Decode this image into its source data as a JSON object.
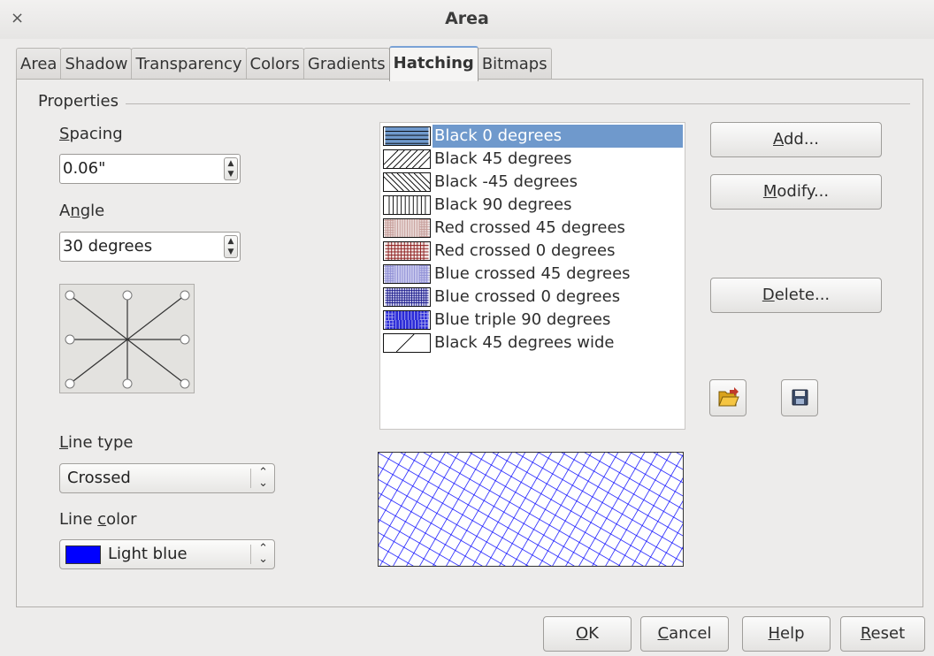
{
  "window": {
    "title": "Area",
    "close_glyph": "×"
  },
  "tabs": [
    {
      "label": "Area"
    },
    {
      "label": "Shadow"
    },
    {
      "label": "Transparency"
    },
    {
      "label": "Colors"
    },
    {
      "label": "Gradients"
    },
    {
      "label": "Hatching",
      "active": true
    },
    {
      "label": "Bitmaps"
    }
  ],
  "properties": {
    "title": "Properties",
    "spacing": {
      "label_u": "S",
      "label_rest": "pacing",
      "value": "0.06\""
    },
    "angle": {
      "label_a": "A",
      "label_u": "n",
      "label_rest": "gle",
      "value": "30 degrees"
    },
    "line_type": {
      "label_u": "L",
      "label_rest": "ine type",
      "value": "Crossed"
    },
    "line_color": {
      "label_a": "Line ",
      "label_u": "c",
      "label_rest": "olor",
      "value": "Light blue",
      "swatch": "#0000ff"
    }
  },
  "hatch_list": [
    {
      "name": "Black 0 degrees",
      "selected": true
    },
    {
      "name": "Black 45 degrees"
    },
    {
      "name": "Black -45 degrees"
    },
    {
      "name": "Black 90 degrees"
    },
    {
      "name": "Red crossed 45 degrees"
    },
    {
      "name": "Red crossed 0 degrees"
    },
    {
      "name": "Blue crossed 45 degrees"
    },
    {
      "name": "Blue crossed 0 degrees"
    },
    {
      "name": "Blue triple 90 degrees"
    },
    {
      "name": "Black 45 degrees wide"
    }
  ],
  "side_buttons": {
    "add": {
      "u": "A",
      "rest": "dd..."
    },
    "modify": {
      "u": "M",
      "rest": "odify..."
    },
    "delete": {
      "u": "D",
      "rest": "elete..."
    }
  },
  "icons": {
    "open": "folder-open-icon",
    "save": "save-icon"
  },
  "footer": {
    "ok": {
      "u": "O",
      "rest": "K"
    },
    "cancel": {
      "u": "C",
      "rest": "ancel"
    },
    "help": {
      "u": "H",
      "rest": "elp"
    },
    "reset": {
      "u": "R",
      "rest": "eset"
    }
  },
  "colors": {
    "selection": "#6f99cc",
    "hatch_blue": "#0000ff",
    "hatch_red": "#8b1a1a"
  }
}
